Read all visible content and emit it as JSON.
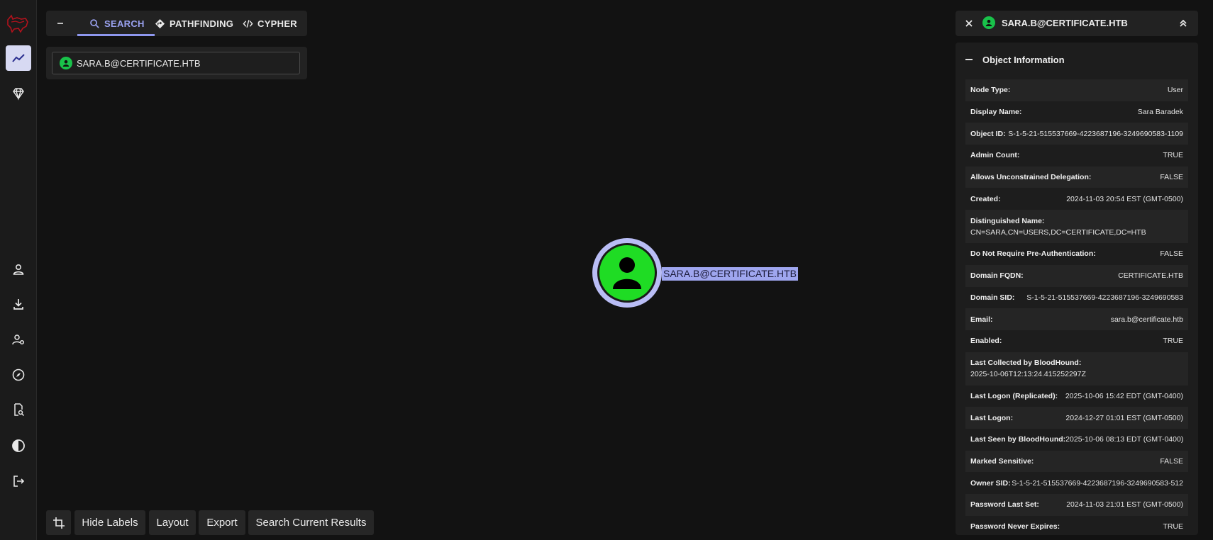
{
  "search": {
    "tabs": [
      {
        "label": "SEARCH",
        "icon": "search-icon"
      },
      {
        "label": "PATHFINDING",
        "icon": "pathfinding-icon"
      },
      {
        "label": "CYPHER",
        "icon": "code-icon"
      }
    ],
    "query_value": "SARA.B@CERTIFICATE.HTB"
  },
  "graph": {
    "node_label": "SARA.B@CERTIFICATE.HTB",
    "node_color": "#1fdc24",
    "highlight_color": "#9fa6ef"
  },
  "toolbar": {
    "hide_labels": "Hide Labels",
    "layout": "Layout",
    "export": "Export",
    "search_results": "Search Current Results"
  },
  "panel": {
    "title": "SARA.B@CERTIFICATE.HTB",
    "section": "Object Information",
    "properties": [
      {
        "key": "Node Type:",
        "value": "User"
      },
      {
        "key": "Display Name:",
        "value": "Sara Baradek"
      },
      {
        "key": "Object ID:",
        "value": "S-1-5-21-515537669-4223687196-3249690583-1109"
      },
      {
        "key": "Admin Count:",
        "value": "TRUE"
      },
      {
        "key": "Allows Unconstrained Delegation:",
        "value": "FALSE"
      },
      {
        "key": "Created:",
        "value": "2024-11-03 20:54 EST (GMT-0500)"
      },
      {
        "key": "Distinguished Name:",
        "value": "CN=SARA,CN=USERS,DC=CERTIFICATE,DC=HTB"
      },
      {
        "key": "Do Not Require Pre-Authentication:",
        "value": "FALSE"
      },
      {
        "key": "Domain FQDN:",
        "value": "CERTIFICATE.HTB"
      },
      {
        "key": "Domain SID:",
        "value": "S-1-5-21-515537669-4223687196-3249690583"
      },
      {
        "key": "Email:",
        "value": "sara.b@certificate.htb"
      },
      {
        "key": "Enabled:",
        "value": "TRUE"
      },
      {
        "key": "Last Collected by BloodHound:",
        "value": "2025-10-06T12:13:24.415252297Z"
      },
      {
        "key": "Last Logon (Replicated):",
        "value": "2025-10-06 15:42 EDT (GMT-0400)"
      },
      {
        "key": "Last Logon:",
        "value": "2024-12-27 01:01 EST (GMT-0500)"
      },
      {
        "key": "Last Seen by BloodHound:",
        "value": "2025-10-06 08:13 EDT (GMT-0400)"
      },
      {
        "key": "Marked Sensitive:",
        "value": "FALSE"
      },
      {
        "key": "Owner SID:",
        "value": "S-1-5-21-515537669-4223687196-3249690583-512"
      },
      {
        "key": "Password Last Set:",
        "value": "2024-11-03 21:01 EST (GMT-0500)"
      },
      {
        "key": "Password Never Expires:",
        "value": "TRUE"
      }
    ]
  }
}
